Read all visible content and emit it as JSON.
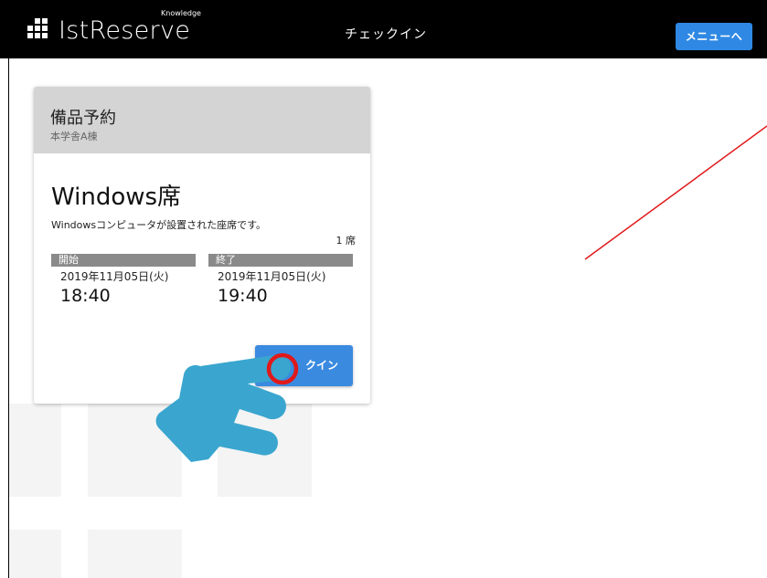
{
  "header": {
    "logo_text": "IstReserve",
    "logo_sub": "Knowledge",
    "title": "チェックイン",
    "menu_label": "メニューへ"
  },
  "card": {
    "category": "備品予約",
    "location": "本学舎A棟",
    "item_name": "Windows席",
    "item_description": "Windowsコンピュータが設置された座席です。",
    "seat_count": "1 席",
    "start": {
      "label": "開始",
      "date": "2019年11月05日(火)",
      "time": "18:40"
    },
    "end": {
      "label": "終了",
      "date": "2019年11月05日(火)",
      "time": "19:40"
    },
    "checkin_label": "クイン"
  },
  "colors": {
    "header_bg": "#000000",
    "accent": "#2f89e4",
    "card_header_bg": "#d4d4d4",
    "time_bar_bg": "#8a8a8a",
    "hand": "#3aa6cf",
    "tap_ring": "#e0191b",
    "pointer_line": "#e0191b"
  },
  "icons": {
    "logo": "grid-logo-icon",
    "hand": "pointing-hand-icon",
    "tap": "tap-ring-icon"
  }
}
